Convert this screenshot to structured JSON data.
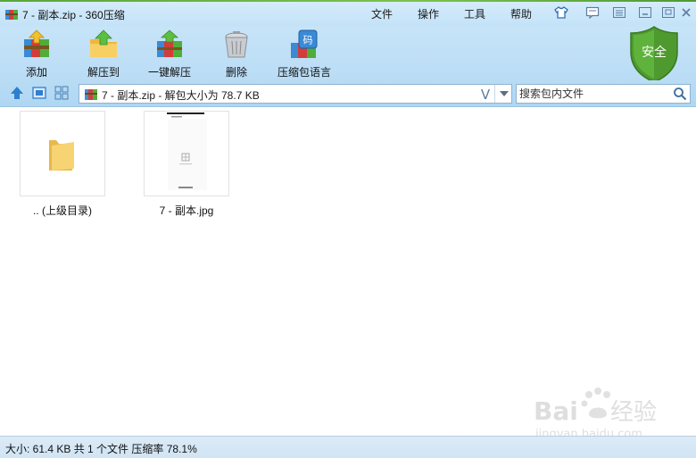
{
  "window": {
    "title": "7 - 副本.zip - 360压缩"
  },
  "menu": {
    "items": [
      {
        "label": "文件"
      },
      {
        "label": "操作"
      },
      {
        "label": "工具"
      },
      {
        "label": "帮助"
      }
    ]
  },
  "toolbar": {
    "buttons": [
      {
        "label": "添加",
        "icon": "add-archive-icon"
      },
      {
        "label": "解压到",
        "icon": "extract-to-icon"
      },
      {
        "label": "一键解压",
        "icon": "one-click-extract-icon"
      },
      {
        "label": "删除",
        "icon": "trash-icon"
      },
      {
        "label": "压缩包语言",
        "icon": "archive-language-icon"
      }
    ],
    "security_badge": "安全"
  },
  "address_bar": {
    "path": "7 - 副本.zip - 解包大小为 78.7 KB",
    "v_label": "V"
  },
  "search": {
    "placeholder": "搜索包内文件"
  },
  "files": [
    {
      "name": ".. (上级目录)",
      "type": "folder"
    },
    {
      "name": "7 - 副本.jpg",
      "type": "image"
    }
  ],
  "status": {
    "text": "大小: 61.4 KB 共 1 个文件 压缩率 78.1%"
  },
  "watermark": {
    "brand": "Bai经验",
    "url": "jingyan.baidu.com"
  },
  "colors": {
    "accent_green": "#5aa53a",
    "shield_green": "#4e9a2f",
    "nav_blue": "#2f7fd0"
  }
}
